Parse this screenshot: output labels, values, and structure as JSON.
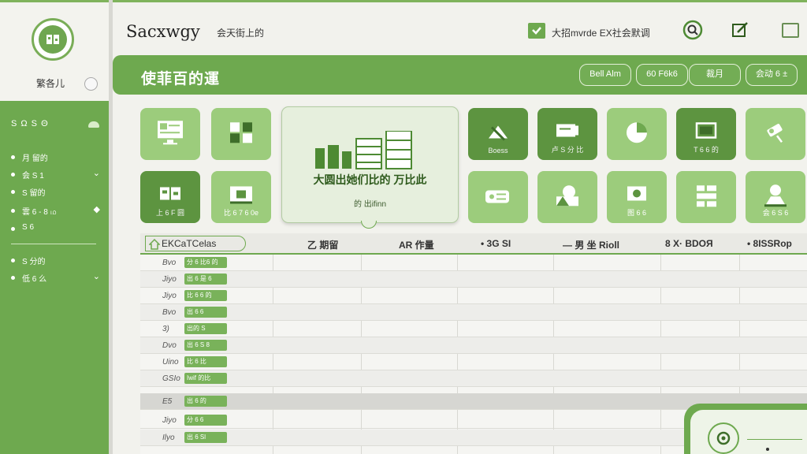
{
  "app": {
    "title": "Sacxwgy",
    "subtitle": "会天街上的"
  },
  "header": {
    "check_label": "大招mvrde",
    "check_label2": "EX社会默调"
  },
  "sidebar": {
    "user_label": "繁各儿",
    "section_title": "S Ω S Θ",
    "items": [
      {
        "label": "月 留的",
        "chevron": ""
      },
      {
        "label": "会 S 1",
        "chevron": "⌄"
      },
      {
        "label": "S 留的",
        "chevron": ""
      },
      {
        "label": "雲 6 - 8 ம",
        "chevron": "◆"
      },
      {
        "label": "S 6",
        "chevron": ""
      },
      {
        "label": "S 分的",
        "chevron": ""
      },
      {
        "label": "低 6 么",
        "chevron": "⌄"
      }
    ]
  },
  "banner": {
    "title": "使菲百的運",
    "buttons": [
      "Bell Alm",
      "60 F6k6",
      "裁月",
      "会动 6 ±"
    ]
  },
  "tiles": [
    {
      "label": ""
    },
    {
      "label": ""
    },
    {
      "label": "Boess"
    },
    {
      "label": "卢 S 分 比"
    },
    {
      "label": ""
    },
    {
      "label": "T 6 6 的"
    },
    {
      "label": ""
    },
    {
      "label": "上 6 F 圆"
    },
    {
      "label": "比 6 7 6 0e"
    },
    {
      "label": ""
    },
    {
      "label": ""
    },
    {
      "label": "图 6 6"
    },
    {
      "label": ""
    },
    {
      "label": "会 6 S 6"
    }
  ],
  "feature": {
    "title": "大圆出她们比的 万比此",
    "subtitle": "的 出ifinn"
  },
  "table": {
    "first_header": "EKCaTCelas",
    "headers": [
      "乙 期留",
      "AR 作量",
      "• 3G SI",
      "— 男 坐 Rioll",
      "8 X· BDOЯ",
      "• 8ISSRop"
    ],
    "rows": [
      {
        "code": "Bvo",
        "tag": "分 6 比6 的"
      },
      {
        "code": "Jiyo",
        "tag": "出 6 是 6"
      },
      {
        "code": "Jiyo",
        "tag": "比 6 6 的"
      },
      {
        "code": "Bvo",
        "tag": "出 6 6"
      },
      {
        "code": "3)",
        "tag": "出的 S"
      },
      {
        "code": "Dvo",
        "tag": "出 6 S 8"
      },
      {
        "code": "Uino",
        "tag": "比 6 比"
      },
      {
        "code": "GSIo",
        "tag": "Iwif 的比"
      },
      {
        "code": "E5",
        "tag": "出 6 的"
      },
      {
        "code": "Jiyo",
        "tag": "分 6 6"
      },
      {
        "code": "Ilyo",
        "tag": "出 6 Sl"
      }
    ]
  },
  "colors": {
    "accent": "#6ea94f",
    "accent_light": "#9ccc7c",
    "accent_dark": "#5d9440",
    "background": "#f2f2ed"
  },
  "icons": [
    "logo-icon",
    "checkbox-icon",
    "search-icon",
    "edit-icon",
    "window-icon",
    "home-icon"
  ]
}
